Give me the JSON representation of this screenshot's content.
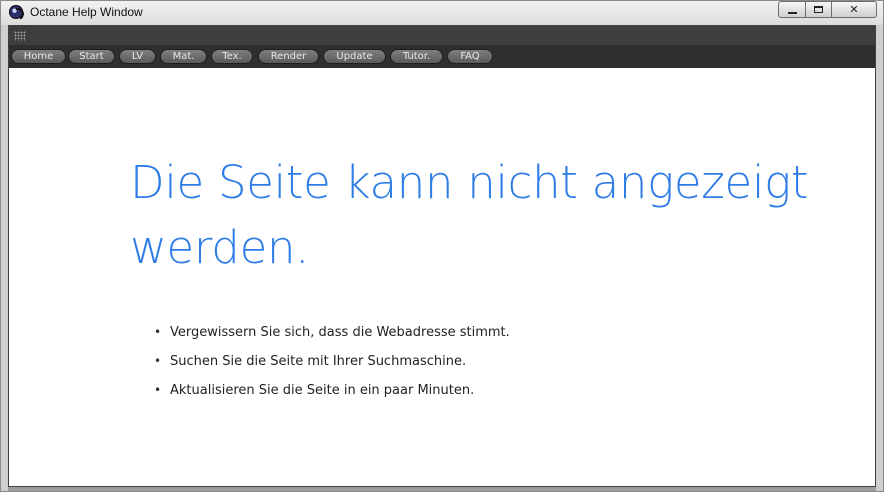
{
  "window": {
    "title": "Octane Help Window"
  },
  "nav": {
    "buttons": [
      {
        "label": "Home"
      },
      {
        "label": "Start"
      },
      {
        "label": "LV"
      },
      {
        "label": "Mat."
      },
      {
        "label": "Tex."
      },
      {
        "label": "Render"
      },
      {
        "label": "Update"
      },
      {
        "label": "Tutor."
      },
      {
        "label": "FAQ"
      }
    ]
  },
  "error_page": {
    "headline": "Die Seite kann nicht angezeigt werden.",
    "tips": [
      "Vergewissern Sie sich, dass die Webadresse stimmt.",
      "Suchen Sie die Seite mit Ihrer Suchmaschine.",
      "Aktualisieren Sie die Seite in ein paar Minuten."
    ]
  },
  "colors": {
    "headline": "#2e7ce6",
    "toolbar": "#2f2f2f",
    "button": "#6a6a6a"
  },
  "icons": {
    "app": "octane-app-icon",
    "grip": "grip-dots-icon",
    "minimize": "minimize-icon",
    "maximize": "maximize-icon",
    "close": "close-icon"
  }
}
